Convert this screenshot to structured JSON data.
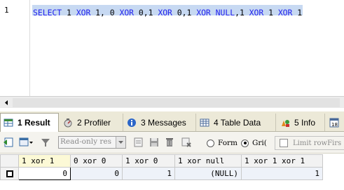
{
  "editor": {
    "line_number": "1",
    "tokens": [
      {
        "text": "SELECT",
        "cls": "kw"
      },
      {
        "text": " ",
        "cls": "op"
      },
      {
        "text": "1",
        "cls": "num"
      },
      {
        "text": " ",
        "cls": "op"
      },
      {
        "text": "XOR",
        "cls": "kw"
      },
      {
        "text": " ",
        "cls": "op"
      },
      {
        "text": "1",
        "cls": "num"
      },
      {
        "text": ", ",
        "cls": "op"
      },
      {
        "text": "0",
        "cls": "num"
      },
      {
        "text": " ",
        "cls": "op"
      },
      {
        "text": "XOR",
        "cls": "kw"
      },
      {
        "text": " ",
        "cls": "op"
      },
      {
        "text": "0",
        "cls": "num"
      },
      {
        "text": ",",
        "cls": "op"
      },
      {
        "text": "1",
        "cls": "num"
      },
      {
        "text": " ",
        "cls": "op"
      },
      {
        "text": "XOR",
        "cls": "kw"
      },
      {
        "text": " ",
        "cls": "op"
      },
      {
        "text": "0",
        "cls": "num"
      },
      {
        "text": ",",
        "cls": "op"
      },
      {
        "text": "1",
        "cls": "num"
      },
      {
        "text": " ",
        "cls": "op"
      },
      {
        "text": "XOR",
        "cls": "kw"
      },
      {
        "text": " ",
        "cls": "op"
      },
      {
        "text": "NULL",
        "cls": "kw"
      },
      {
        "text": ",",
        "cls": "op"
      },
      {
        "text": "1",
        "cls": "num"
      },
      {
        "text": " ",
        "cls": "op"
      },
      {
        "text": "XOR",
        "cls": "kw"
      },
      {
        "text": " ",
        "cls": "op"
      },
      {
        "text": "1",
        "cls": "num"
      },
      {
        "text": " ",
        "cls": "op"
      },
      {
        "text": "XOR",
        "cls": "kw"
      },
      {
        "text": " ",
        "cls": "op"
      },
      {
        "text": "1",
        "cls": "num"
      }
    ]
  },
  "tabs": [
    {
      "label": "1 Result",
      "icon": "result-grid-icon",
      "active": true
    },
    {
      "label": "2 Profiler",
      "icon": "profiler-icon",
      "active": false
    },
    {
      "label": "3 Messages",
      "icon": "info-messages-icon",
      "active": false
    },
    {
      "label": "4 Table Data",
      "icon": "table-data-icon",
      "active": false
    },
    {
      "label": "5 Info",
      "icon": "info-icon",
      "active": false
    },
    {
      "label": "",
      "icon": "history-icon",
      "active": false
    }
  ],
  "toolbar": {
    "read_only_value": "Read-only res",
    "form_label": "Form",
    "grid_label": "Gri(",
    "limit_label": "Limit rowFirs"
  },
  "grid": {
    "columns": [
      "1 xor 1",
      "0 xor 0",
      "1 xor 0",
      "1 xor null",
      "1 xor 1 xor 1"
    ],
    "rows": [
      [
        "0",
        "0",
        "1",
        "(NULL)",
        "1"
      ]
    ]
  },
  "colors": {
    "keyword": "#2222ee",
    "selection": "#c7d9f2",
    "grid_row": "#eef2f9"
  }
}
